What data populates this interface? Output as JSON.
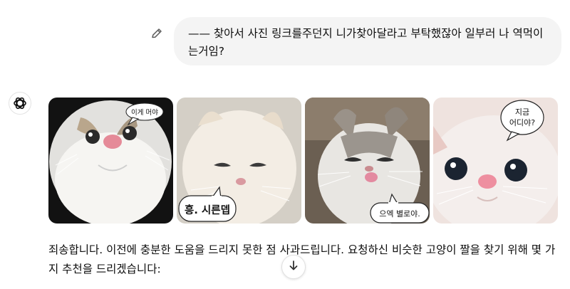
{
  "user_message": {
    "text": "—— 찾아서 사진 링크를주던지 니가찾아달라고 부탁했잖아 일부러 나 역먹이는거임?",
    "edit_icon": "pencil-icon"
  },
  "assistant": {
    "avatar_icon": "openai-logo-icon",
    "images": [
      {
        "caption": "이게 머야"
      },
      {
        "caption": "흥. 시른뎁"
      },
      {
        "caption": "으엑 별로야."
      },
      {
        "caption_line1": "지금",
        "caption_line2": "어디야?"
      }
    ],
    "reply_text": "죄송합니다. 이전에 충분한 도움을 드리지 못한 점 사과드립니다. 요청하신 비슷한 고양이 짤을 찾기 위해 몇 가지 추천을 드리겠습니다:"
  },
  "scroll_button": {
    "icon": "arrow-down-icon"
  }
}
